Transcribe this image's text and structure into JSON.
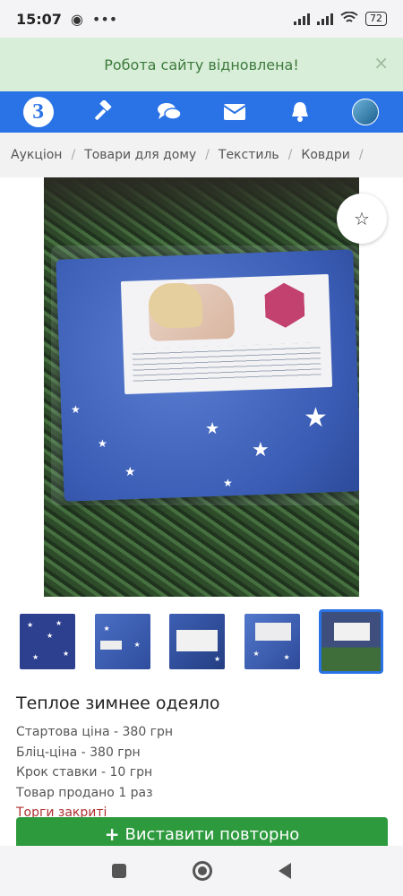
{
  "status_bar": {
    "time": "15:07",
    "battery": "72",
    "left_icons": [
      "chrome-icon",
      "more-dots-icon"
    ],
    "right_icons": [
      "signal-icon",
      "signal-icon",
      "wifi-icon",
      "battery-icon"
    ]
  },
  "notice": {
    "text": "Робота сайту відновлена!",
    "close_label": "×"
  },
  "navbar": {
    "logo_text": "З",
    "items": [
      "auction-hammer-icon",
      "chat-icon",
      "mail-icon",
      "bell-icon",
      "avatar"
    ]
  },
  "breadcrumb": {
    "items": [
      "Аукціон",
      "Товари для дому",
      "Текстиль",
      "Ковдри"
    ],
    "separator": "/"
  },
  "product": {
    "favorite_icon": "☆",
    "thumbnails_count": 5,
    "active_thumbnail": 5,
    "title": "Теплое зимнее одеяло",
    "start_price": "Стартова ціна - 380 грн",
    "blitz_price": "Бліц-ціна - 380 грн",
    "bid_step": "Крок ставки - 10 грн",
    "sold": "Товар продано 1 раз",
    "status": "Торги закриті",
    "repost_button": "Виставити повторно",
    "repost_icon": "+"
  },
  "colors": {
    "brand_blue": "#2a73e6",
    "success_green": "#2e9a3e",
    "notice_bg": "#d8eed8",
    "closed_red": "#b03030"
  }
}
